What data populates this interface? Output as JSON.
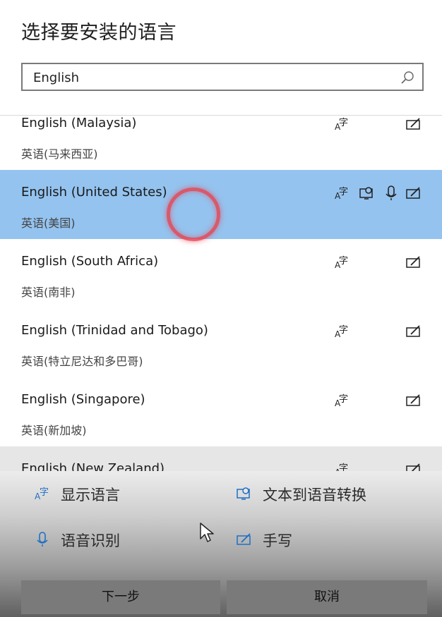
{
  "title": "选择要安装的语言",
  "search": {
    "value": "English"
  },
  "languages": [
    {
      "name": "English (Malaysia)",
      "native": "英语(马来西亚)",
      "features": [
        "display-language",
        "handwriting"
      ]
    },
    {
      "name": "English (United States)",
      "native": "英语(美国)",
      "features": [
        "display-language",
        "text-to-speech",
        "speech-recognition",
        "handwriting"
      ],
      "selected": true
    },
    {
      "name": "English (South Africa)",
      "native": "英语(南非)",
      "features": [
        "display-language",
        "handwriting"
      ]
    },
    {
      "name": "English (Trinidad and Tobago)",
      "native": "英语(特立尼达和多巴哥)",
      "features": [
        "display-language",
        "handwriting"
      ]
    },
    {
      "name": "English (Singapore)",
      "native": "英语(新加坡)",
      "features": [
        "display-language",
        "handwriting"
      ]
    },
    {
      "name": "English (New Zealand)",
      "native": "",
      "features": [
        "display-language",
        "handwriting"
      ]
    }
  ],
  "legend": {
    "display_language": "显示语言",
    "text_to_speech": "文本到语音转换",
    "speech_recognition": "语音识别",
    "handwriting": "手写"
  },
  "buttons": {
    "next": "下一步",
    "cancel": "取消"
  },
  "colors": {
    "selected_row": "#94c3ef",
    "accent_icon": "#1f6fc5"
  }
}
